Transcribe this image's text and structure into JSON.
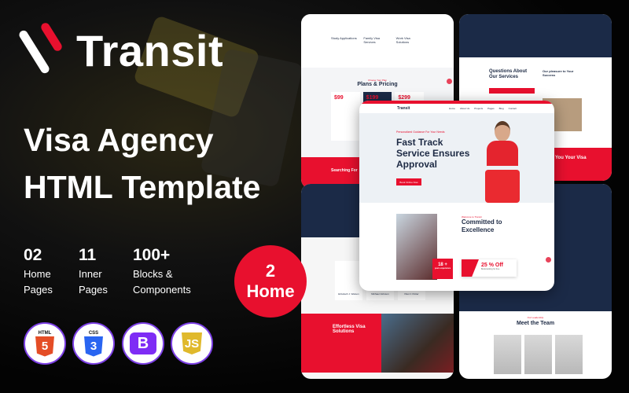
{
  "brand": {
    "name": "Transit",
    "accent": "#e8102e"
  },
  "headline": {
    "line1": "Visa Agency",
    "line2": "HTML Template"
  },
  "stats": [
    {
      "value": "02",
      "label1": "Home",
      "label2": "Pages"
    },
    {
      "value": "11",
      "label1": "Inner",
      "label2": "Pages"
    },
    {
      "value": "100+",
      "label1": "Blocks &",
      "label2": "Components"
    }
  ],
  "badge": {
    "line1": "2",
    "line2": "Home"
  },
  "tech": [
    {
      "name": "html5-icon",
      "label": "HTML",
      "glyph": "5",
      "color": "#e44d26"
    },
    {
      "name": "css3-icon",
      "label": "CSS",
      "glyph": "3",
      "color": "#1572b6"
    },
    {
      "name": "bootstrap-icon",
      "label": "",
      "glyph": "B",
      "color": "#7952b3"
    },
    {
      "name": "javascript-icon",
      "label": "",
      "glyph": "JS",
      "color": "#e0b92c"
    }
  ],
  "mockups": {
    "hero": {
      "eyebrow": "Personalized Guidance For Your Needs",
      "title1": "Fast Track",
      "title2": "Service Ensures",
      "title3": "Approval",
      "button": "Book Online Now",
      "nav": [
        "Home",
        "About Us",
        "Projects",
        "Pages",
        "Blog",
        "Contact"
      ]
    },
    "about": {
      "eyebrow": "Welcome to Transit",
      "title1": "Committed to",
      "title2": "Excellence",
      "exp_num": "18 +",
      "exp_label": "years experience",
      "offer": "25 % Off",
      "offer_sub": "Bookmarking for free"
    },
    "pricing": {
      "eyebrow": "Choose Your Plan",
      "title": "Plans & Pricing",
      "prices": [
        "$99",
        "$199",
        "$299"
      ],
      "services": [
        "Study Applications",
        "Family Visa Services",
        "Work Visa Solutions"
      ],
      "banner": "Searching For"
    },
    "faq": {
      "title1": "Questions About",
      "title2": "Our Services",
      "side1": "Our pleasure to Your",
      "side2": "Success",
      "banner": "You Your Visa"
    },
    "solutions": {
      "title1": "Effortless Visa",
      "title2": "Solutions",
      "team": [
        "Elizabeth J. Watson",
        "Michael Johnson",
        "Paul J. Potter"
      ]
    },
    "team": {
      "eyebrow": "Our Leadership",
      "title": "Meet the Team"
    }
  }
}
